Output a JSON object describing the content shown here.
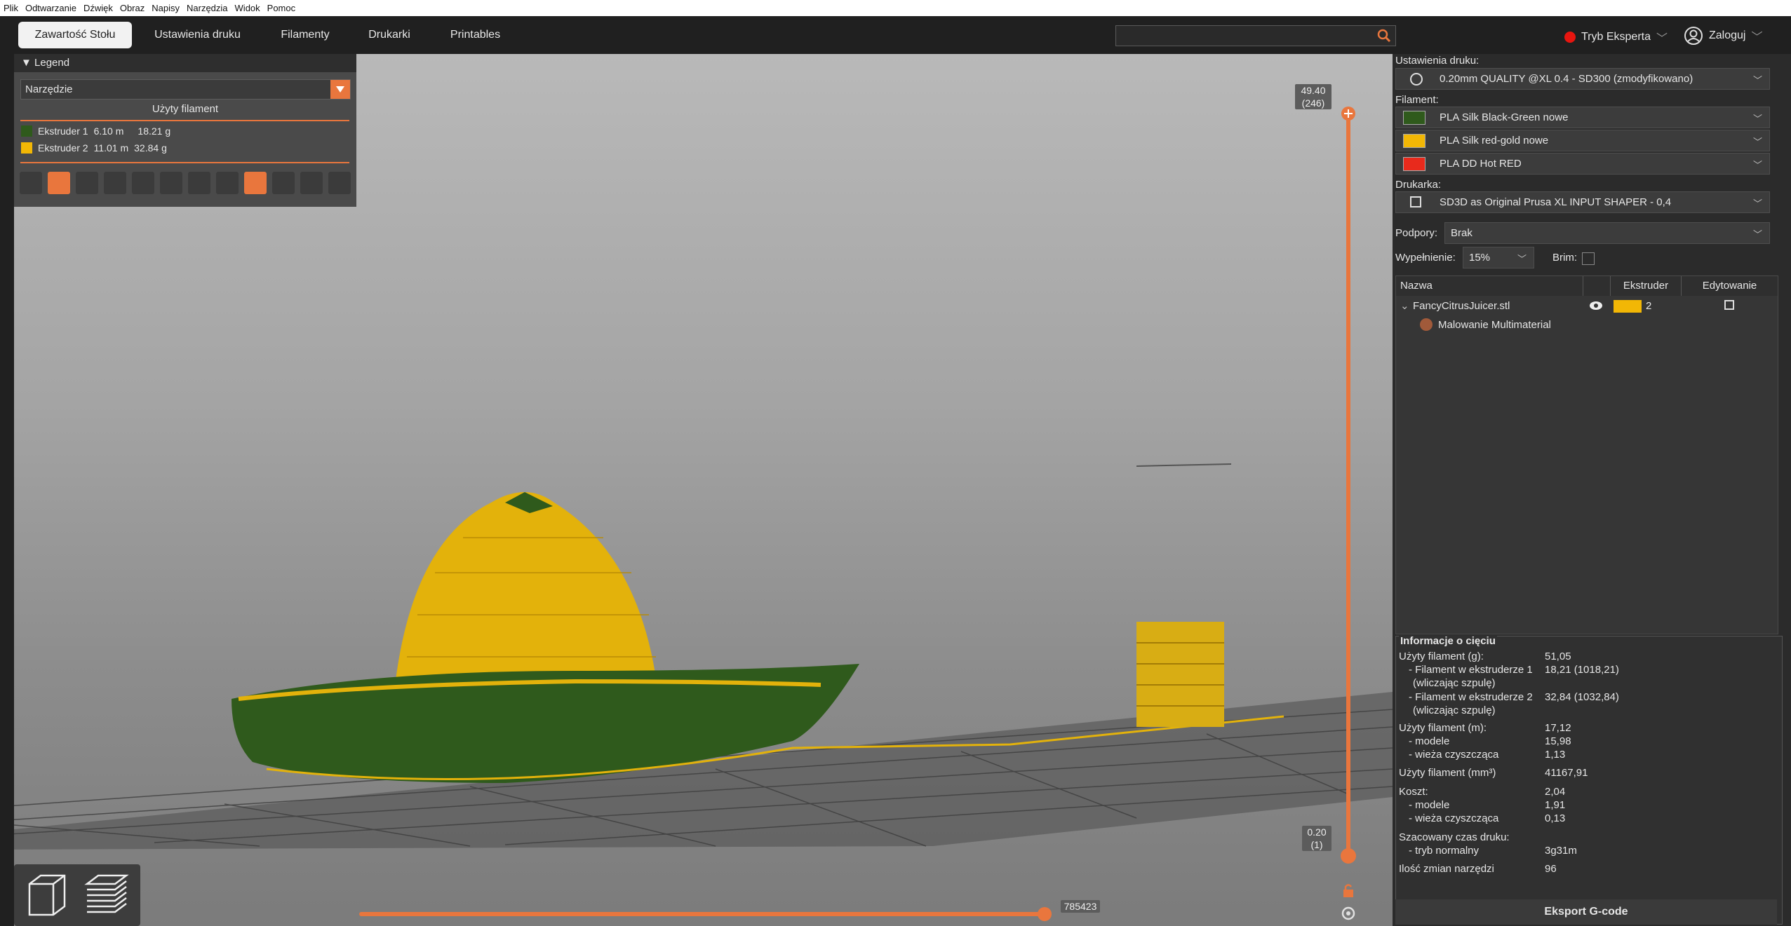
{
  "menu": [
    "Plik",
    "Odtwarzanie",
    "Dźwięk",
    "Obraz",
    "Napisy",
    "Narzędzia",
    "Widok",
    "Pomoc"
  ],
  "tabs": [
    "Zawartość Stołu",
    "Ustawienia druku",
    "Filamenty",
    "Drukarki",
    "Printables"
  ],
  "search": {
    "placeholder": ""
  },
  "mode_label": "Tryb Eksperta",
  "login_label": "Zaloguj",
  "legend": {
    "title": "Legend",
    "tool": "Narzędzie",
    "subtitle": "Użyty filament",
    "extruders": [
      {
        "name": "Ekstruder 1",
        "length": "6.10 m",
        "weight": "18.21 g",
        "color": "#2f5a1c"
      },
      {
        "name": "Ekstruder 2",
        "length": "11.01 m",
        "weight": "32.84 g",
        "color": "#f2b705"
      }
    ]
  },
  "vslider": {
    "top_value": "49.40",
    "top_layer": "(246)",
    "bottom_value": "0.20",
    "bottom_layer": "(1)"
  },
  "hslider": {
    "value": "785423"
  },
  "panel": {
    "print_settings_label": "Ustawienia druku:",
    "print_profile": "0.20mm QUALITY @XL 0.4 - SD300 (zmodyfikowano)",
    "filament_label": "Filament:",
    "filaments": [
      {
        "name": "PLA Silk Black-Green nowe",
        "color": "#2f5a1c"
      },
      {
        "name": "PLA Silk red-gold nowe",
        "color": "#f2b705"
      },
      {
        "name": "PLA DD Hot RED",
        "color": "#e82a1c"
      }
    ],
    "printer_label": "Drukarka:",
    "printer": "SD3D as Original Prusa XL INPUT SHAPER - 0,4",
    "supports_label": "Podpory:",
    "supports": "Brak",
    "infill_label": "Wypełnienie:",
    "infill": "15%",
    "brim_label": "Brim:",
    "columns": [
      "Nazwa",
      "Ekstruder",
      "Edytowanie"
    ],
    "object": {
      "name": "FancyCitrusJuicer.stl",
      "extruder": "2",
      "child": "Malowanie Multimaterial"
    },
    "info": {
      "title": "Informacje o cięciu",
      "rows": [
        {
          "label": "Użyty filament (g):",
          "value": "51,05"
        },
        {
          "label": "- Filament w ekstruderze 1",
          "value": "18,21 (1018,21)"
        },
        {
          "label": "(wliczając szpulę)",
          "value": ""
        },
        {
          "label": "- Filament w ekstruderze 2",
          "value": "32,84 (1032,84)"
        },
        {
          "label": "(wliczając szpulę)",
          "value": ""
        },
        {
          "label": "Użyty filament (m):",
          "value": "17,12"
        },
        {
          "label": "- modele",
          "value": "15,98"
        },
        {
          "label": "- wieża czyszcząca",
          "value": "1,13"
        },
        {
          "label": "Użyty filament (mm³)",
          "value": "41167,91"
        },
        {
          "label": "Koszt:",
          "value": "2,04"
        },
        {
          "label": "- modele",
          "value": "1,91"
        },
        {
          "label": "- wieża czyszcząca",
          "value": "0,13"
        },
        {
          "label": "Szacowany czas druku:",
          "value": ""
        },
        {
          "label": "- tryb normalny",
          "value": "3g31m"
        },
        {
          "label": "Ilość zmian narzędzi",
          "value": "96"
        }
      ]
    },
    "export_label": "Eksport G-code"
  }
}
